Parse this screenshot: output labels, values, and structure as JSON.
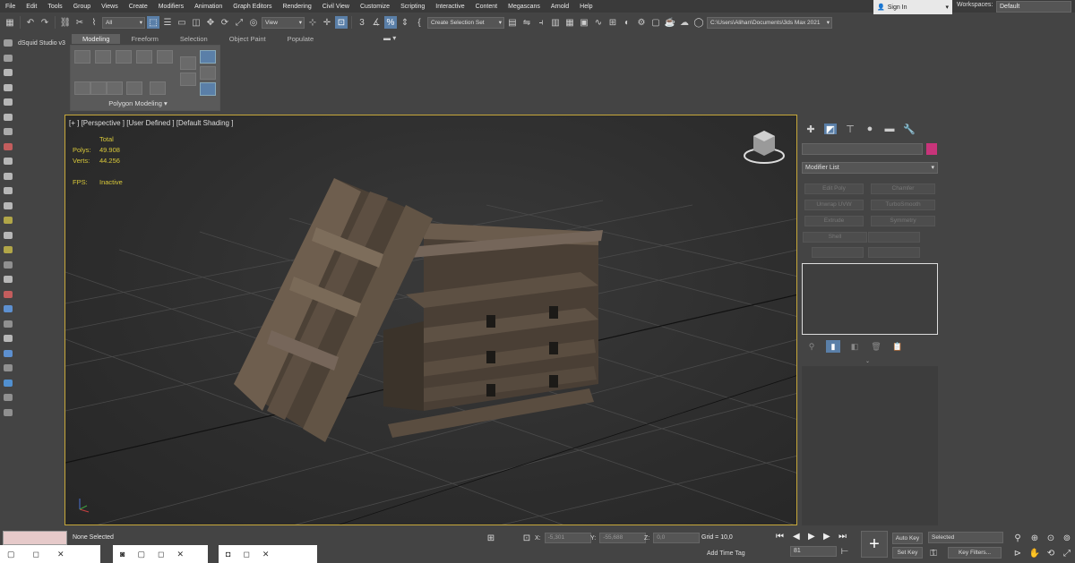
{
  "menu": [
    "File",
    "Edit",
    "Tools",
    "Group",
    "Views",
    "Create",
    "Modifiers",
    "Animation",
    "Graph Editors",
    "Rendering",
    "Civil View",
    "Customize",
    "Scripting",
    "Interactive",
    "Content",
    "Megascans",
    "Arnold",
    "Help"
  ],
  "signin": "Sign In",
  "workspaces_label": "Workspaces:",
  "workspace": "Default",
  "toolbar": {
    "selection_filter": "All",
    "ref_coord": "View",
    "selection_set": "Create Selection Set",
    "project_path": "C:\\Users\\Alihan\\Documents\\3ds Max 2021"
  },
  "side_plugin": "dSquid Studio v3",
  "ribbon": {
    "tabs": [
      "Modeling",
      "Freeform",
      "Selection",
      "Object Paint",
      "Populate"
    ],
    "panel_label": "Polygon Modeling"
  },
  "viewport": {
    "label": "[+ ] [Perspective ] [User Defined ] [Default Shading ]",
    "total": "Total",
    "polys_label": "Polys:",
    "polys": "49.908",
    "verts_label": "Verts:",
    "verts": "44.256",
    "fps_label": "FPS:",
    "fps": "Inactive"
  },
  "command_panel": {
    "modifier_list": "Modifier List",
    "buttons": [
      "Edit Poly",
      "Chamfer",
      "Unwrap UVW",
      "TurboSmooth",
      "Extrude",
      "Symmetry",
      "Shell"
    ]
  },
  "status": {
    "selection": "None Selected",
    "x_label": "X:",
    "x": "-5,301",
    "y_label": "Y:",
    "y": "-55,688",
    "z_label": "Z:",
    "z": "0,0",
    "grid": "Grid = 10,0",
    "add_time_tag": "Add Time Tag",
    "frame": "81",
    "auto_key": "Auto Key",
    "set_key": "Set Key",
    "key_mode": "Selected",
    "key_filters": "Key Filters..."
  },
  "colors": {
    "accent": "#5a7fa8",
    "viewport_border": "#c7a83a",
    "stats_text": "#d8c83a",
    "object_color": "#c8347a"
  }
}
